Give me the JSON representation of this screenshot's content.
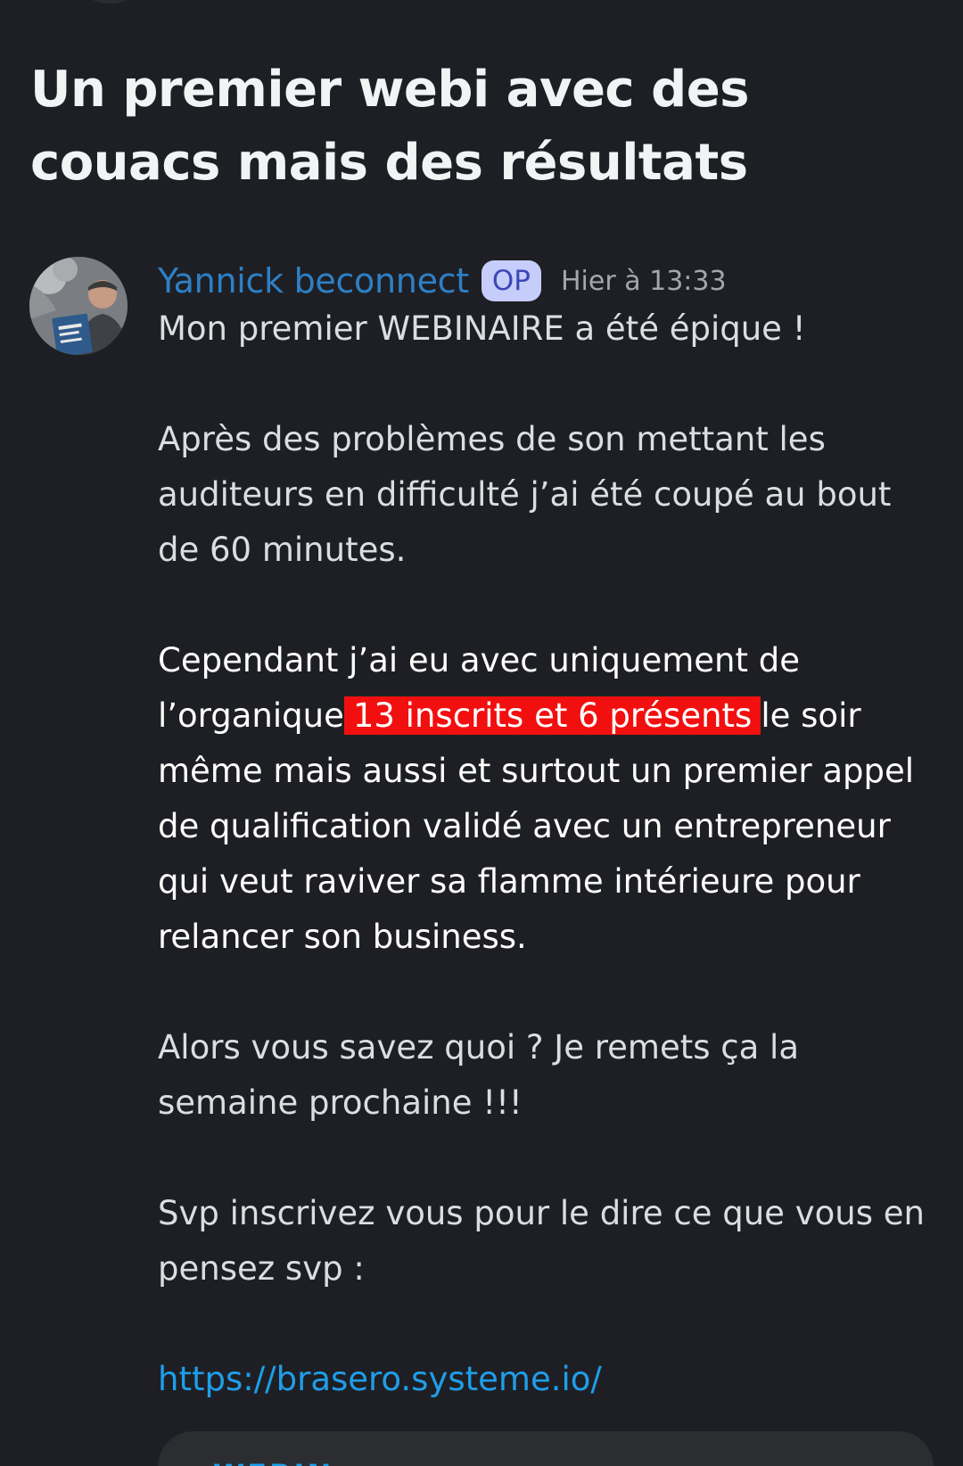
{
  "thread": {
    "title": "Un premier webi avec des couacs mais des résultats"
  },
  "message": {
    "author": "Yannick beconnect",
    "badge": "OP",
    "timestamp": "Hier à 13:33",
    "avatar_icon": "user-avatar-photo",
    "paragraph_1": "Mon premier WEBINAIRE a été épique !",
    "paragraph_2": "Après des problèmes de son mettant les auditeurs en difficulté j’ai été coupé au bout de 60 minutes.",
    "paragraph_3_before": "Cependant j’ai eu avec uniquement de l’organique",
    "paragraph_3_highlight": "13 inscrits et 6 présents",
    "paragraph_3_after": "le soir même mais aussi et surtout un premier appel de qualification validé avec un entrepreneur qui veut raviver sa flamme intérieure pour relancer son business.",
    "paragraph_4": "Alors vous savez quoi ? Je remets ça la semaine prochaine !!!",
    "paragraph_5": "Svp inscrivez vous pour le dire ce que vous en pensez svp :",
    "link": "https://brasero.systeme.io/"
  },
  "embed": {
    "partial_text": "WEBIN"
  },
  "colors": {
    "background": "#1e1f24",
    "author_name": "#2d80c6",
    "badge_bg": "#c6cdfa",
    "highlight": "#f20f0f",
    "link": "#1f9ee9"
  }
}
